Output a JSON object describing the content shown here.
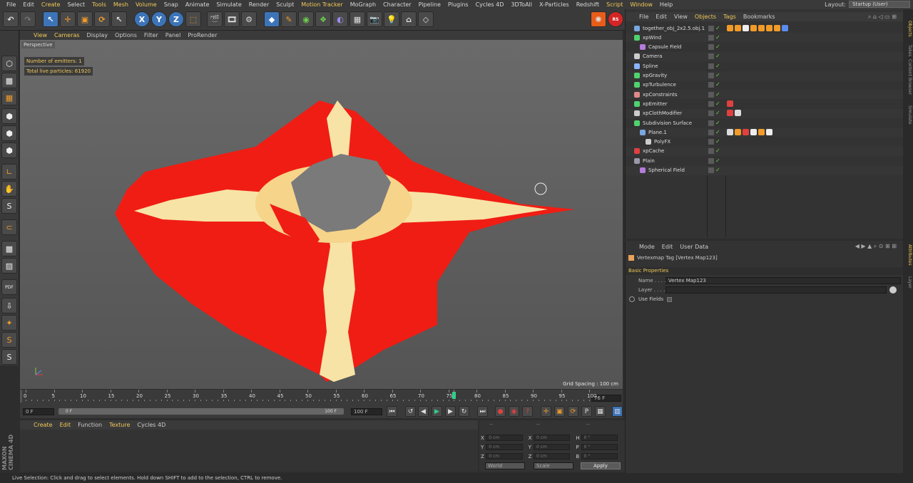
{
  "menu": {
    "items": [
      "File",
      "Edit",
      "Create",
      "Select",
      "Tools",
      "Mesh",
      "Volume",
      "Snap",
      "Animate",
      "Simulate",
      "Render",
      "Sculpt",
      "Motion Tracker",
      "MoGraph",
      "Character",
      "Pipeline",
      "Plugins",
      "Cycles 4D",
      "3DToAll",
      "X-Particles",
      "Redshift",
      "Script",
      "Window",
      "Help"
    ],
    "highlighted": [
      "Motion Tracker",
      "Script",
      "Window",
      "Tools",
      "Mesh",
      "Volume",
      "Create"
    ],
    "layout_label": "Layout:",
    "layout_value": "Startup (User)"
  },
  "viewport": {
    "menu": [
      "View",
      "Cameras",
      "Display",
      "Options",
      "Filter",
      "Panel",
      "ProRender"
    ],
    "label": "Perspective",
    "hud_emitters": "Number of emitters: 1",
    "hud_particles": "Total live particles: 61920",
    "grid_spacing": "Grid Spacing : 100 cm"
  },
  "timeline": {
    "ticks": [
      "0",
      "5",
      "10",
      "15",
      "20",
      "25",
      "30",
      "35",
      "40",
      "45",
      "50",
      "55",
      "60",
      "65",
      "70",
      "75",
      "76",
      "80",
      "85",
      "90",
      "95",
      "100"
    ],
    "current_frame": "76 F",
    "start_field": "0 F",
    "min_field": "0 F",
    "end_field": "100 F",
    "max_field": "100 F",
    "playhead_fraction": 0.76
  },
  "material": {
    "menu": [
      "Create",
      "Edit",
      "Function",
      "Texture",
      "Cycles 4D"
    ]
  },
  "coords": {
    "rows": [
      {
        "a": "X",
        "av": "0 cm",
        "b": "X",
        "bv": "0 cm",
        "c": "H",
        "cv": "0 °"
      },
      {
        "a": "Y",
        "av": "0 cm",
        "b": "Y",
        "bv": "0 cm",
        "c": "P",
        "cv": "0 °"
      },
      {
        "a": "Z",
        "av": "0 cm",
        "b": "Z",
        "bv": "0 cm",
        "c": "B",
        "cv": "0 °"
      }
    ],
    "mode1": "World",
    "mode2": "Scale",
    "apply": "Apply"
  },
  "objects": {
    "menu": [
      "File",
      "Edit",
      "View",
      "Objects",
      "Tags",
      "Bookmarks"
    ],
    "items": [
      {
        "name": "together_obj_2x2.5.obj.1",
        "indent": 0,
        "color": "#7aa7e0"
      },
      {
        "name": "xpWind",
        "indent": 0,
        "color": "#4fd36e"
      },
      {
        "name": "Capsule Field",
        "indent": 1,
        "color": "#b47bdc"
      },
      {
        "name": "Camera",
        "indent": 0,
        "color": "#cccccc"
      },
      {
        "name": "Spline",
        "indent": 0,
        "color": "#8ab4ff"
      },
      {
        "name": "xpGravity",
        "indent": 0,
        "color": "#4fd36e"
      },
      {
        "name": "xpTurbulence",
        "indent": 0,
        "color": "#4fd36e"
      },
      {
        "name": "xpConstraints",
        "indent": 0,
        "color": "#e08a8a"
      },
      {
        "name": "xpEmitter",
        "indent": 0,
        "color": "#4fd36e"
      },
      {
        "name": "xpClothModifier",
        "indent": 0,
        "color": "#cccccc"
      },
      {
        "name": "Subdivision Surface",
        "indent": 0,
        "color": "#4fd36e"
      },
      {
        "name": "Plane.1",
        "indent": 1,
        "color": "#7aa7e0"
      },
      {
        "name": "PolyFX",
        "indent": 2,
        "color": "#cccccc"
      },
      {
        "name": "xpCache",
        "indent": 0,
        "color": "#e04040"
      },
      {
        "name": "Plain",
        "indent": 0,
        "color": "#9999aa"
      },
      {
        "name": "Spherical Field",
        "indent": 1,
        "color": "#b47bdc"
      }
    ]
  },
  "attributes": {
    "menu": [
      "Mode",
      "Edit",
      "User Data"
    ],
    "title": "Vertexmap Tag [Vertex Map123]",
    "section": "Basic Properties",
    "name_label": "Name . . . .",
    "name_value": "Vertex Map123",
    "layer_label": "Layer . . . .",
    "use_fields": "Use Fields"
  },
  "status": "Live Selection: Click and drag to select elements. Hold down SHIFT to add to the selection, CTRL to remove.",
  "brand": "MAXON CINEMA 4D",
  "side_tabs": [
    "Objects",
    "Takes",
    "Content Browser",
    "Simulate",
    "Attributes",
    "Layer"
  ]
}
